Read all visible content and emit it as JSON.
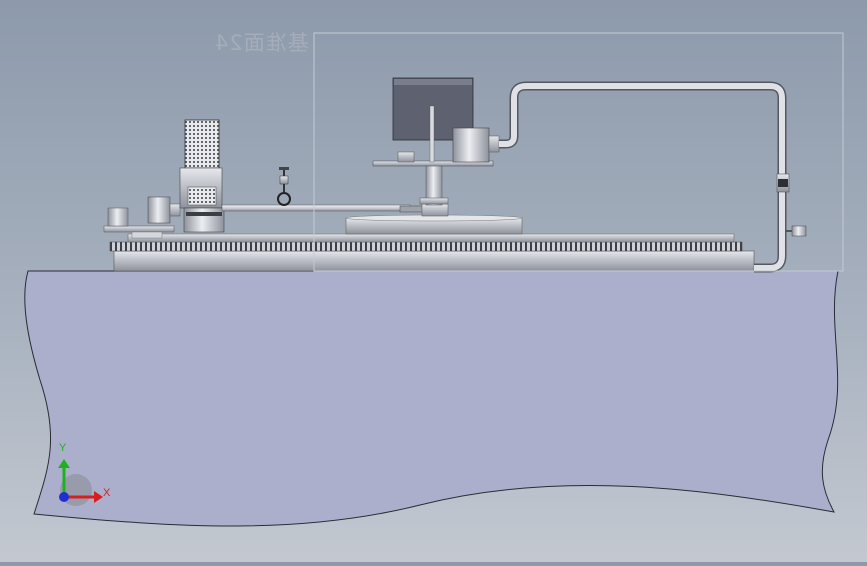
{
  "viewport": {
    "plane_label": "基准面24",
    "triad": {
      "x_label": "X",
      "y_label": "Y"
    },
    "colors": {
      "background_top": "#8d9aab",
      "background_bottom": "#c3c8d0",
      "base_fill": "#abafcb",
      "plane_outline": "#c4cad3",
      "axis_x": "#d42020",
      "axis_y": "#20b020",
      "axis_z": "#2030d0"
    }
  }
}
